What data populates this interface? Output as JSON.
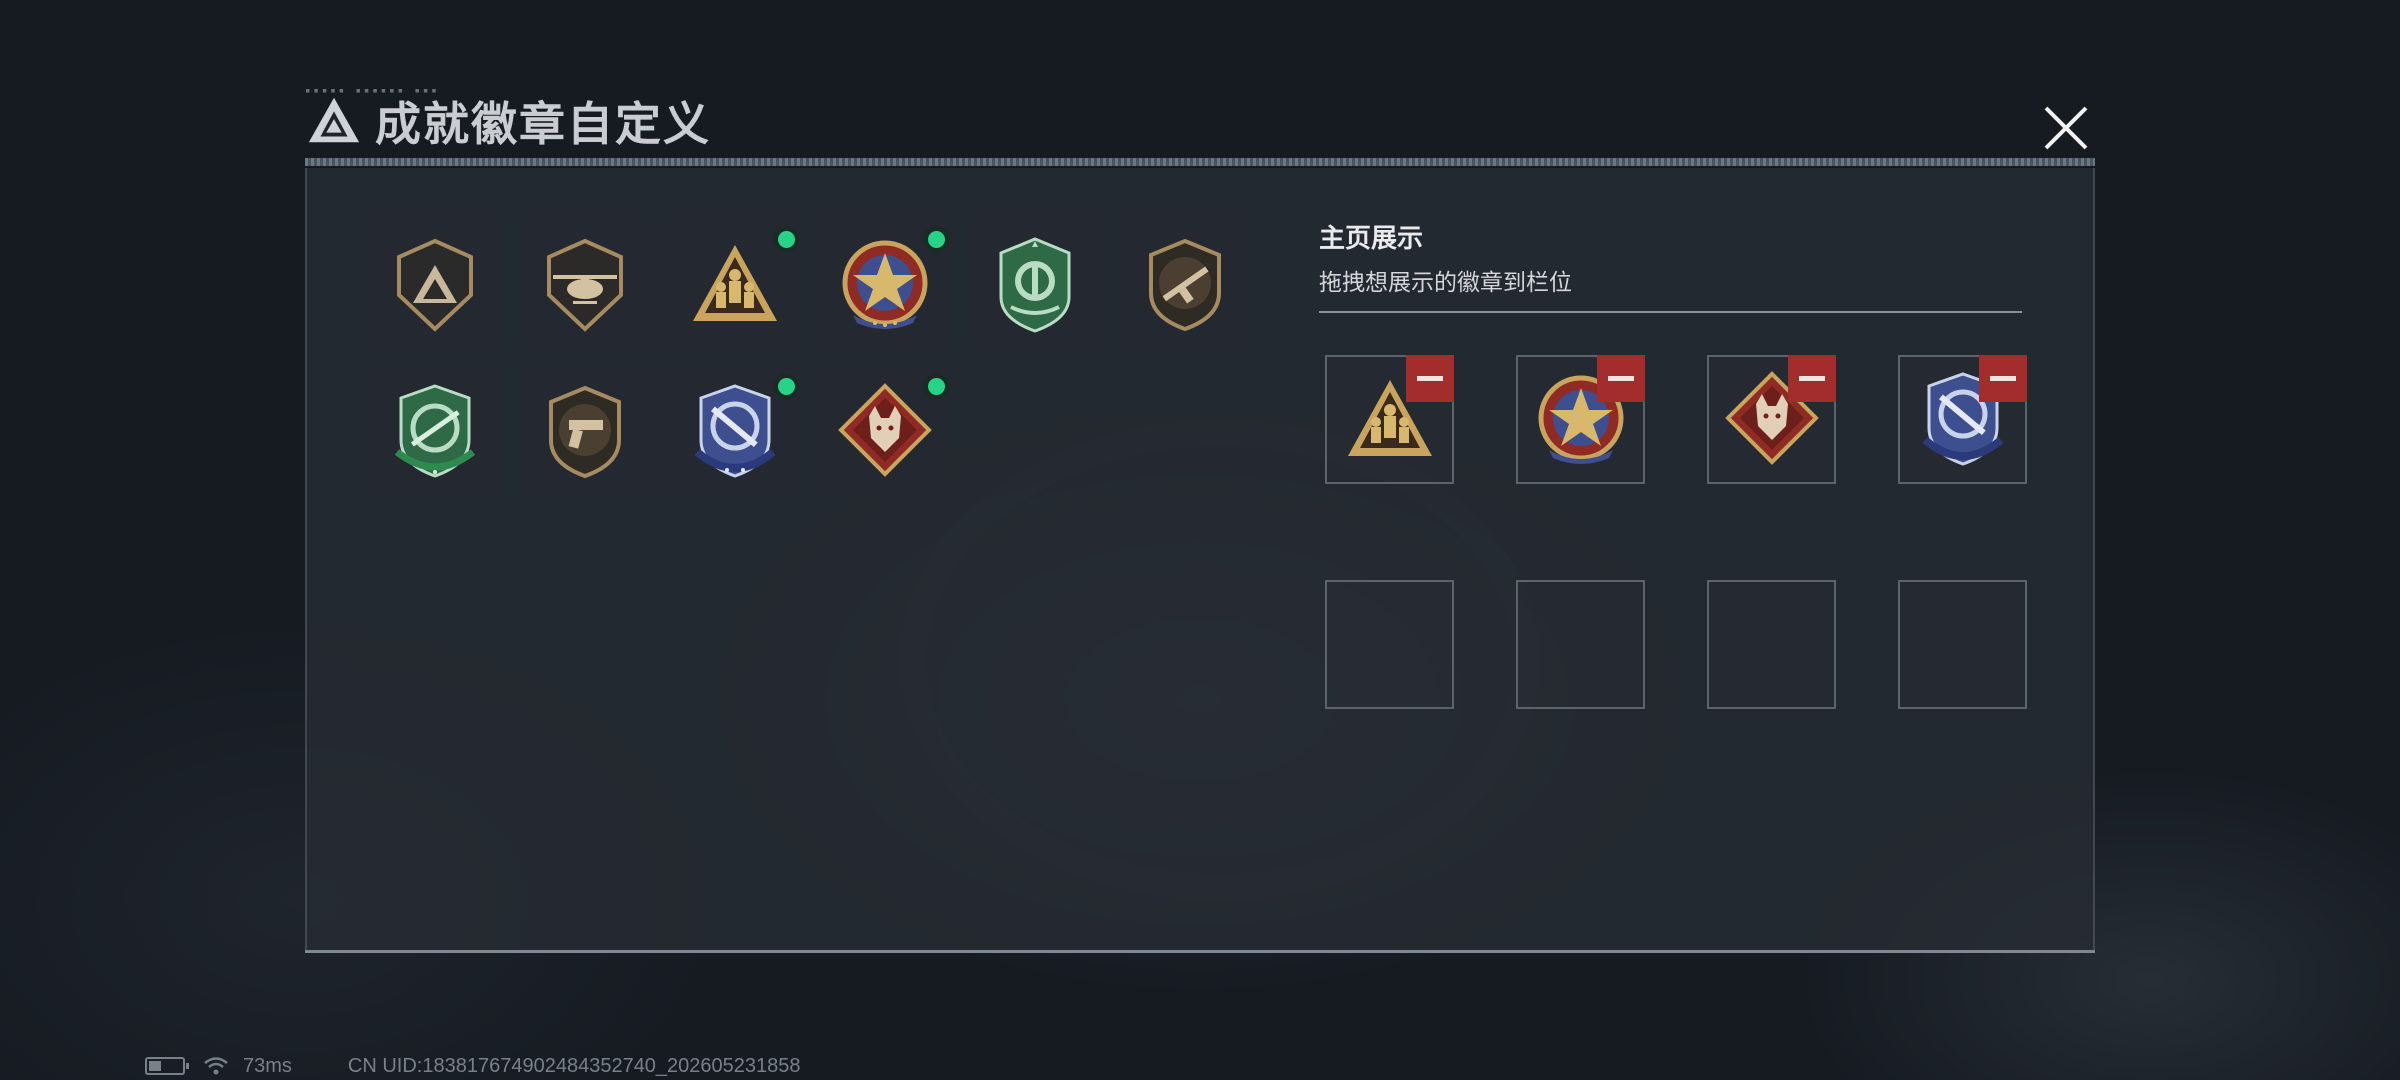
{
  "header": {
    "title": "成就徽章自定义",
    "logo_icon": "triangle-logo-icon",
    "close_icon": "close-icon"
  },
  "inventory": {
    "badges": [
      {
        "icon": "triangle-shield-badge-icon",
        "palette": "bronze",
        "new": false
      },
      {
        "icon": "helicopter-shield-badge-icon",
        "palette": "bronze",
        "new": false
      },
      {
        "icon": "soldiers-triangle-badge-icon",
        "palette": "gold",
        "new": true
      },
      {
        "icon": "star-medal-badge-icon",
        "palette": "gold-red",
        "new": true
      },
      {
        "icon": "green-wreath-badge-icon",
        "palette": "green",
        "new": false
      },
      {
        "icon": "rifle-shield-badge-icon",
        "palette": "bronze",
        "new": false
      },
      {
        "icon": "green-crosshair-badge-icon",
        "palette": "green",
        "new": false
      },
      {
        "icon": "pistol-shield-badge-icon",
        "palette": "bronze",
        "new": false
      },
      {
        "icon": "blue-crosshair-badge-icon",
        "palette": "blue",
        "new": true
      },
      {
        "icon": "wolf-diamond-badge-icon",
        "palette": "red",
        "new": true
      }
    ]
  },
  "showcase": {
    "title": "主页展示",
    "subtitle": "拖拽想展示的徽章到栏位",
    "slots": [
      {
        "badge": "soldiers-triangle-badge-icon",
        "filled": true
      },
      {
        "badge": "star-medal-badge-icon",
        "filled": true
      },
      {
        "badge": "wolf-diamond-badge-icon",
        "filled": true
      },
      {
        "badge": "blue-crosshair-badge-icon",
        "filled": true
      },
      {
        "filled": false
      },
      {
        "filled": false
      },
      {
        "filled": false
      },
      {
        "filled": false
      }
    ],
    "remove_icon": "minus-icon"
  },
  "status": {
    "ping": "73ms",
    "uid": "CN UID:183817674902484352740_202605231858"
  },
  "colors": {
    "accent_green": "#27d386",
    "remove_red": "#a32d2c",
    "gold": "#c9a45c",
    "bronze": "#a58b5f",
    "green": "#3f8a5a",
    "blue": "#3d4f8f"
  }
}
